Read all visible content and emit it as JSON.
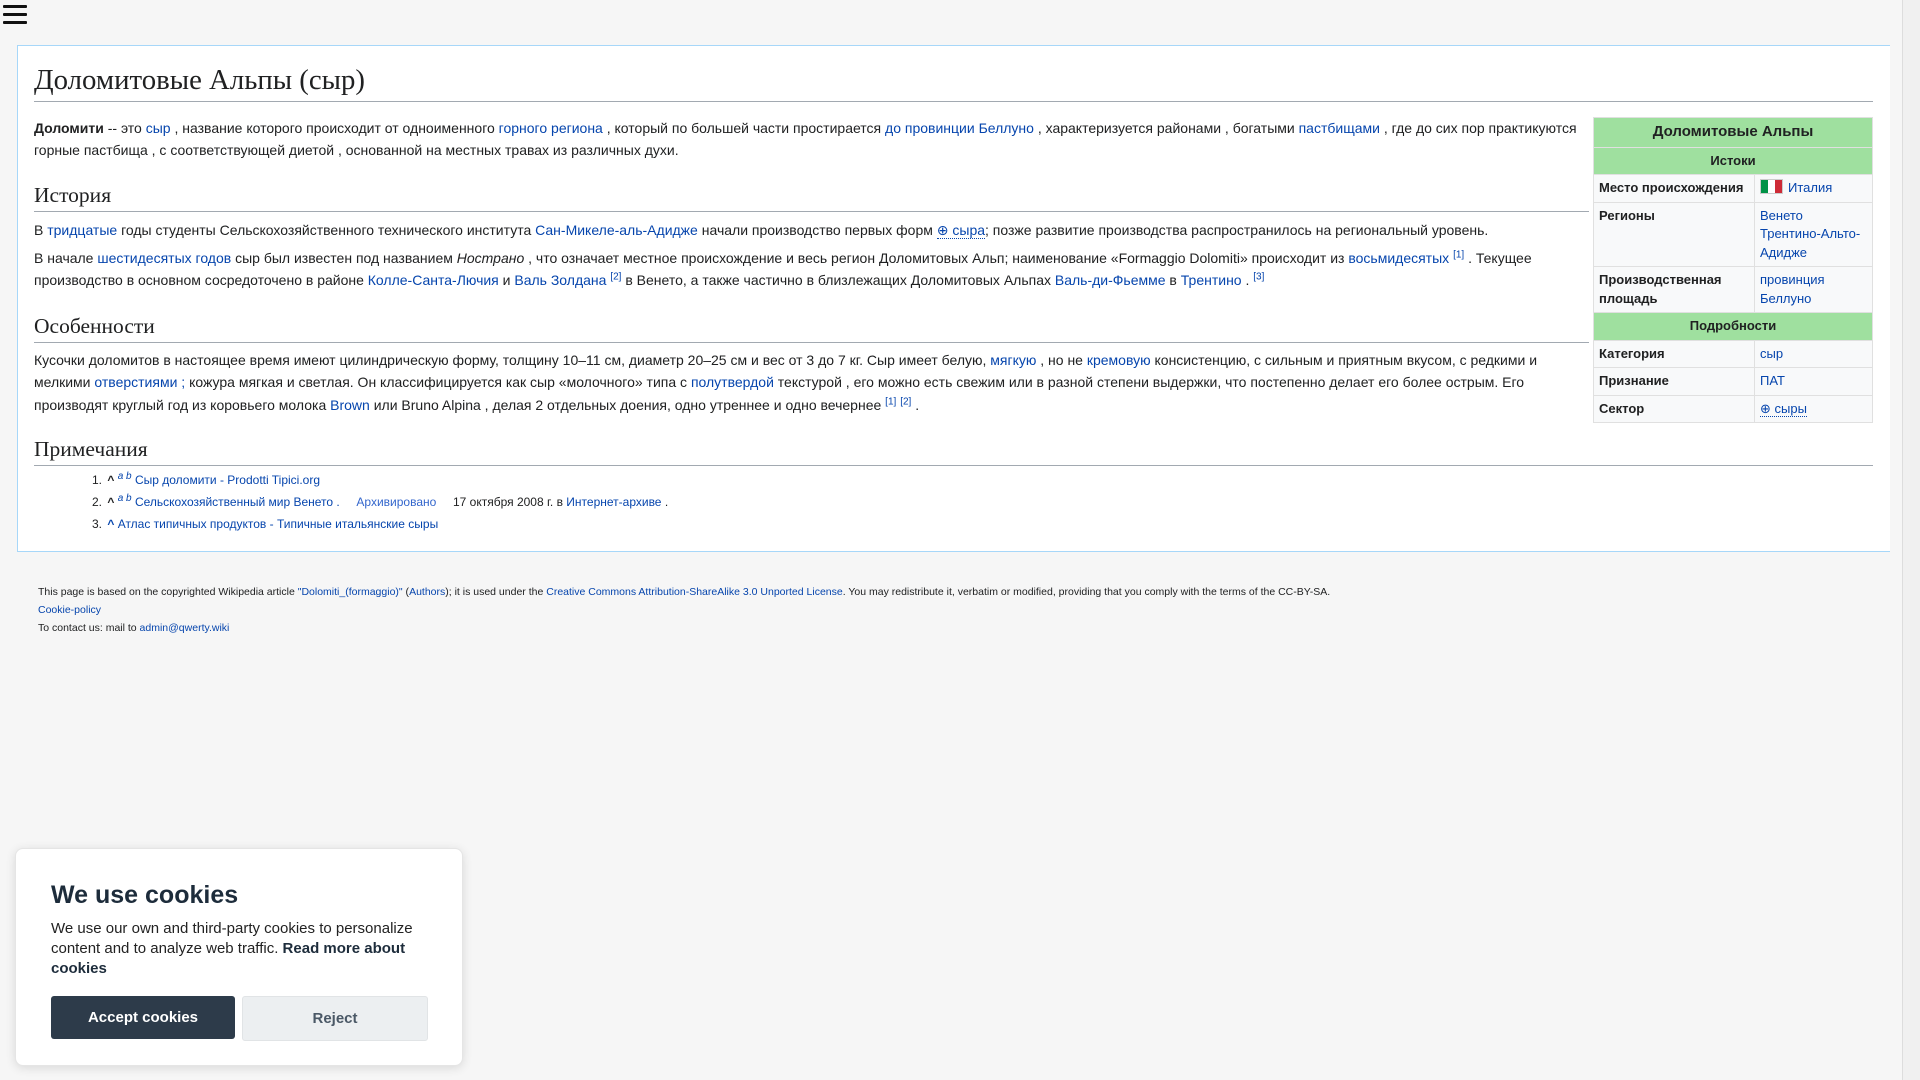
{
  "title": "Доломитовые Альпы (сыр)",
  "intro": {
    "bold": "Доломити",
    "t1": " -- это ",
    "l1": "сыр",
    "t2": " , название которого происходит от одноименного ",
    "l2": "горного региона",
    "t3": " , который по большей части простирается ",
    "l3": "до провинции Беллуно",
    "t4": " , характеризуется районами , богатыми ",
    "l4": "пастбищами",
    "t5": " , где до сих пор практикуются горные пастбища , с соответствующей диетой , основанной на местных травах из различных духи."
  },
  "history": {
    "heading": "История",
    "p1": {
      "t1": "В ",
      "l1": "тридцатые",
      "t2": " годы студенты Сельскохозяйственного технического института ",
      "l2": "Сан-Микеле-аль-Адидже",
      "t3": " начали производство первых форм ",
      "l3": "сыра",
      "t4": "; позже развитие производства распространилось на региональный уровень."
    },
    "p2": {
      "t1": "В начале ",
      "l1": "шестидесятых годов",
      "t2": " сыр был известен под названием ",
      "em": "Нострано",
      "t3": " , что означает местное происхождение и весь регион Доломитовых Альп; наименование «Formaggio Dolomiti» происходит из ",
      "l2": "восьмидесятых",
      "s1": "[1]",
      "t4": " . Текущее производство в основном сосредоточено в районе ",
      "l3": "Колле-Санта-Лючия",
      "t5": " и ",
      "l4": "Валь Золдана",
      "s2": "[2]",
      "t6": " в Венето, а также частично в близлежащих Доломитовых Альпах ",
      "l5": "Валь-ди-Фьемме",
      "t7": " в ",
      "l6": "Трентино",
      "t8": " . ",
      "s3": "[3]"
    }
  },
  "features": {
    "heading": "Особенности",
    "t1": "Кусочки доломитов в настоящее время имеют цилиндрическую форму, толщину 10–11 см, диаметр 20–25 см и вес от 3 до 7 кг. Сыр имеет белую, ",
    "l1": "мягкую",
    "t2": " , но не ",
    "l2": "кремовую",
    "t3": " консистенцию, с сильным и приятным вкусом, с редкими и мелкими ",
    "l3": "отверстиями ;",
    "t4": " кожура мягкая и светлая. Он классифицируется как сыр «молочного» типа с ",
    "l4": "полутвердой",
    "t5": " текстурой , его можно есть свежим или в разной степени выдержки, что постепенно делает его более острым. Его производят круглый год из коровьего молока ",
    "l5": "Brown",
    "t6": " или Bruno Alpina , делая 2 отдельных доения, одно утреннее и одно вечернее ",
    "s1": "[1]",
    "s2": "[2]",
    "t7": " ."
  },
  "notes": {
    "heading": "Примечания",
    "items": [
      {
        "num": "1.",
        "caret": "^",
        "sup": "a b",
        "link": "Сыр доломити - Prodotti Tipici.org"
      },
      {
        "num": "2.",
        "caret": "^",
        "sup": "a b",
        "link": "Сельскохозяйственный мир Венето .",
        "archived": "Архивировано",
        "date": "17 октября 2008 г. в",
        "archive": "Интернет-архиве",
        "end": "."
      },
      {
        "num": "3.",
        "caret": "^",
        "link": "Атлас типичных продуктов - Типичные итальянские сыры"
      }
    ]
  },
  "infobox": {
    "title": "Доломитовые Альпы",
    "section1": "Истоки",
    "origin_label": "Место происхождения",
    "origin_value": "Италия",
    "regions_label": "Регионы",
    "regions": [
      "Венето",
      "Трентино-Альто-Адидже"
    ],
    "area_label": "Производственная площадь",
    "area_value": "провинция Беллуно",
    "section2": "Подробности",
    "category_label": "Категория",
    "category_value": "сыр",
    "recognition_label": "Признание",
    "recognition_value": "ПАТ",
    "sector_label": "Сектор",
    "sector_value": "сыры"
  },
  "footer": {
    "t1": "This page is based on the copyrighted Wikipedia article ",
    "article": "\"Dolomiti_(formaggio)\"",
    "t2": " (",
    "authors": "Authors",
    "t3": "); it is used under the ",
    "license": "Creative Commons Attribution-ShareAlike 3.0 Unported License",
    "t4": ". You may redistribute it, verbatim or modified, providing that you comply with the terms of the CC-BY-SA.",
    "cookie_policy": "Cookie-policy",
    "contact": "To contact us: mail to ",
    "email": "admin@qwerty.wiki"
  },
  "cookie": {
    "title": "We use cookies",
    "text": "We use our own and third-party cookies to personalize content and to analyze web traffic. ",
    "read_more": "Read more about cookies",
    "accept": "Accept cookies",
    "reject": "Reject"
  }
}
